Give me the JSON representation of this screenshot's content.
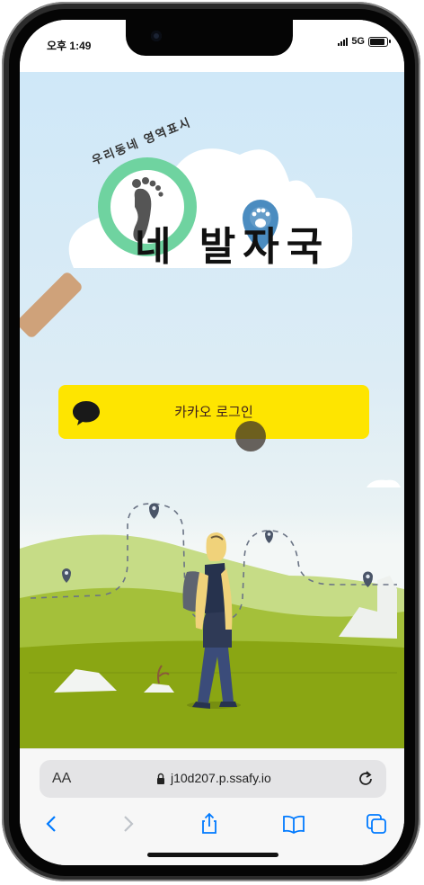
{
  "status_bar": {
    "time": "오후 1:49",
    "network": "5G"
  },
  "app": {
    "logo_tagline": "우리동네 영역표시",
    "logo_title": "네 발자국",
    "login_button": {
      "label": "카카오 로그인",
      "icon": "speech-bubble-icon"
    }
  },
  "browser": {
    "text_size_label": "AA",
    "url": "j10d207.p.ssafy.io",
    "toolbar": [
      "back-icon",
      "forward-icon",
      "share-icon",
      "bookmarks-icon",
      "tabs-icon"
    ]
  },
  "colors": {
    "kakao_yellow": "#fee500",
    "grass": "#8aa613",
    "accent_blue": "#007aff"
  }
}
